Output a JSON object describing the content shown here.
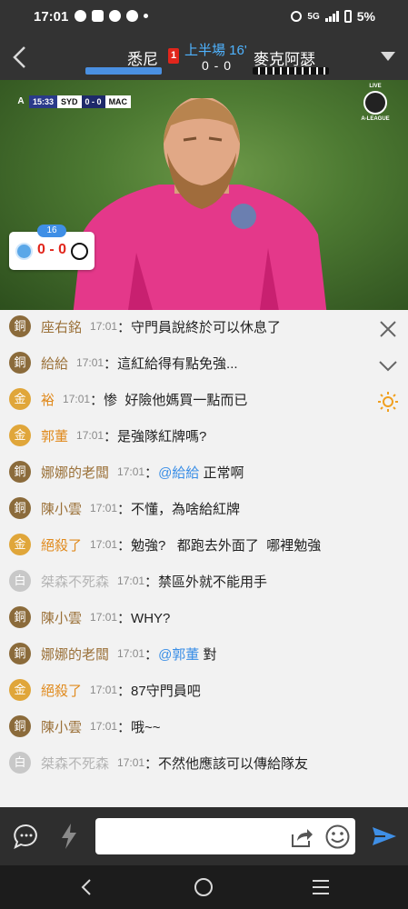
{
  "status_bar": {
    "time": "17:01",
    "network": "5G",
    "battery": "5%"
  },
  "match_header": {
    "home_team": "悉尼",
    "away_team": "麥克阿瑟",
    "red_cards_home": "1",
    "period": "上半場 16'",
    "score": "0 - 0",
    "home_color": "#4a90e2"
  },
  "video": {
    "scorebug": {
      "league_logo": "A",
      "clock": "15:33",
      "home_abbr": "SYD",
      "score": "0 - 0",
      "away_abbr": "MAC"
    },
    "live_badge": {
      "top": "LIVE",
      "bottom": "A-LEAGUE"
    },
    "overlay": {
      "minute": "16",
      "score": "0 - 0"
    }
  },
  "chat": {
    "messages": [
      {
        "badge": "銅",
        "tier": "copper",
        "user": "座右銘",
        "time": "17:01",
        "text": "：守門員說終於可以休息了"
      },
      {
        "badge": "銅",
        "tier": "copper",
        "user": "給給",
        "time": "17:01",
        "text": "：這紅給得有點免強..."
      },
      {
        "badge": "金",
        "tier": "gold",
        "user": "裕",
        "time": "17:01",
        "text": "：惨  好險他媽買一點而已"
      },
      {
        "badge": "金",
        "tier": "gold",
        "user": "郭董",
        "time": "17:01",
        "text": "：是強隊紅牌嗎?"
      },
      {
        "badge": "銅",
        "tier": "copper",
        "user": "娜娜的老闆",
        "time": "17:01",
        "text_prefix": "：",
        "mention": "@給給",
        "text": " 正常啊"
      },
      {
        "badge": "銅",
        "tier": "copper",
        "user": "陳小雲",
        "time": "17:01",
        "text": "：不懂，為啥給紅牌"
      },
      {
        "badge": "金",
        "tier": "gold",
        "user": "絕殺了",
        "time": "17:01",
        "text": "：勉強?   都跑去外面了  哪裡勉強"
      },
      {
        "badge": "白",
        "tier": "white",
        "user": "桀森不死森",
        "time": "17:01",
        "text": "：禁區外就不能用手"
      },
      {
        "badge": "銅",
        "tier": "copper",
        "user": "陳小雲",
        "time": "17:01",
        "text": "：WHY?"
      },
      {
        "badge": "銅",
        "tier": "copper",
        "user": "娜娜的老闆",
        "time": "17:01",
        "text_prefix": "：",
        "mention": "@郭董",
        "text": " 對"
      },
      {
        "badge": "金",
        "tier": "gold",
        "user": "絕殺了",
        "time": "17:01",
        "text": "：87守門員吧"
      },
      {
        "badge": "銅",
        "tier": "copper",
        "user": "陳小雲",
        "time": "17:01",
        "text": "：哦~~"
      },
      {
        "badge": "白",
        "tier": "white",
        "user": "桀森不死森",
        "time": "17:01",
        "text": "：不然他應該可以傳給隊友"
      }
    ],
    "tools": [
      "close-icon",
      "chevron-down-icon",
      "sun-icon"
    ]
  },
  "input_bar": {
    "placeholder": "",
    "send_color": "#3f8fe6"
  },
  "icons": [
    "back-arrow-icon",
    "dropdown-triangle-icon",
    "chat-bubble-icon",
    "lightning-icon",
    "share-icon",
    "emoji-icon",
    "send-icon",
    "nav-back-icon",
    "nav-home-icon",
    "nav-recents-icon"
  ]
}
